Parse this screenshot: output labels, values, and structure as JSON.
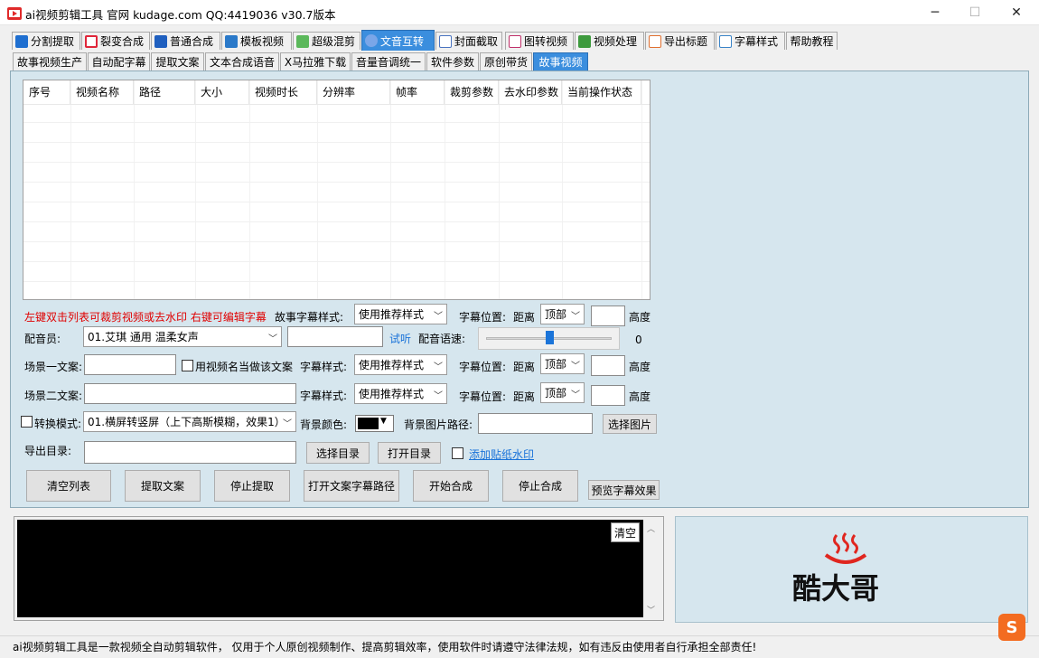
{
  "window": {
    "title": "ai视频剪辑工具 官网 kudage.com QQ:4419036    v30.7版本",
    "minimize": "─",
    "maximize": "☐",
    "close": "✕"
  },
  "main_tabs": [
    {
      "label": "分割提取",
      "icon_color": "#1f6fd0"
    },
    {
      "label": "裂变合成",
      "icon_color": "#e0263a"
    },
    {
      "label": "普通合成",
      "icon_color": "#1f5fbf"
    },
    {
      "label": "模板视频",
      "icon_color": "#2a79c9"
    },
    {
      "label": "超级混剪",
      "icon_color": "#5bb85b"
    },
    {
      "label": "文音互转",
      "icon_color": "#7aa6e8"
    },
    {
      "label": "封面截取",
      "icon_color": "#4a74c0"
    },
    {
      "label": "图转视频",
      "icon_color": "#c0306a"
    },
    {
      "label": "视频处理",
      "icon_color": "#3e9a3e"
    },
    {
      "label": "导出标题",
      "icon_color": "#e07030"
    },
    {
      "label": "字幕样式",
      "icon_color": "#3a84c8"
    },
    {
      "label": "帮助教程",
      "icon_color": ""
    }
  ],
  "sub_tabs": [
    "故事视频生产",
    "自动配字幕",
    "提取文案",
    "文本合成语音",
    "X马拉雅下载",
    "音量音调统一",
    "软件参数",
    "原创带货",
    "故事视频"
  ],
  "table": {
    "columns": [
      "序号",
      "视频名称",
      "路径",
      "大小",
      "视频时长",
      "分辨率",
      "帧率",
      "裁剪参数",
      "去水印参数",
      "当前操作状态"
    ]
  },
  "form": {
    "hint": "左键双击列表可裁剪视频或去水印 右键可编辑字幕",
    "story_style_label": "故事字幕样式:",
    "style_value": "使用推荐样式",
    "position_label": "字幕位置:",
    "distance_label": "距离",
    "position_value": "顶部",
    "height_label": "高度",
    "voice_label": "配音员:",
    "voice_value": "01.艾琪 通用 温柔女声",
    "try_listen": "试听",
    "speed_label": "配音语速:",
    "speed_value": "0",
    "speed_fraction": 0.5,
    "scene1_label": "场景一文案:",
    "use_name_label": "用视频名当做该文案",
    "style_label": "字幕样式:",
    "scene2_label": "场景二文案:",
    "mode_label": "转换模式:",
    "mode_value": "01.横屏转竖屏（上下高斯模糊，效果1）",
    "bg_color_label": "背景颜色:",
    "bg_color": "#000000",
    "bg_image_label": "背景图片路径:",
    "choose_image": "选择图片",
    "export_label": "导出目录:",
    "choose_dir": "选择目录",
    "open_dir": "打开目录",
    "add_watermark": "添加贴纸水印"
  },
  "actions": [
    "清空列表",
    "提取文案",
    "停止提取",
    "打开文案字幕路径",
    "开始合成",
    "停止合成"
  ],
  "preview_button": "预览字幕效果",
  "log": {
    "clear_button": "清空"
  },
  "logo": {
    "text": "酷大哥",
    "accent": "#e0261f"
  },
  "status_text": "ai视频剪辑工具是一款视频全自动剪辑软件， 仅用于个人原创视频制作、提高剪辑效率，使用软件时请遵守法律法规，如有违反由使用者自行承担全部责任!"
}
